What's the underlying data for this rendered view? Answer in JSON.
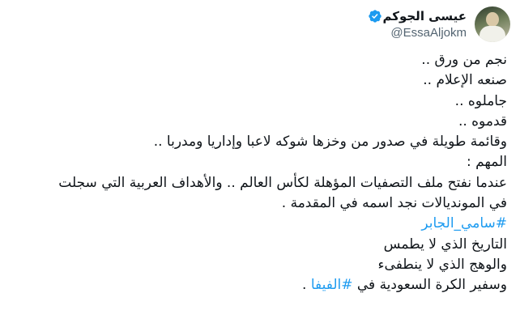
{
  "user": {
    "display_name": "عيسى الجوكم",
    "handle": "@EssaAljokm",
    "verified_color": "#1d9bf0"
  },
  "tweet": {
    "line1": "نجم من ورق ..",
    "line2": "صنعه الإعلام ..",
    "line3": "جاملوه ..",
    "line4": "قدموه ..",
    "line5": "وقائمة طويلة في صدور من وخزها شوكه لاعبا وإداريا ومدربا ..",
    "line6": "المهم :",
    "line7": "عندما نفتح ملف التصفيات المؤهلة لكأس العالم .. والأهداف العربية التي سجلت",
    "line8": "في المونديالات نجد اسمه في المقدمة .",
    "hashtag1": "#سامي_الجابر",
    "line10": "التاريخ الذي لا يطمس",
    "line11": "والوهج الذي لا ينطفىء",
    "line12_text": "وسفير الكرة السعودية في ",
    "hashtag2": "#الفيفا",
    "line12_end": " ."
  }
}
